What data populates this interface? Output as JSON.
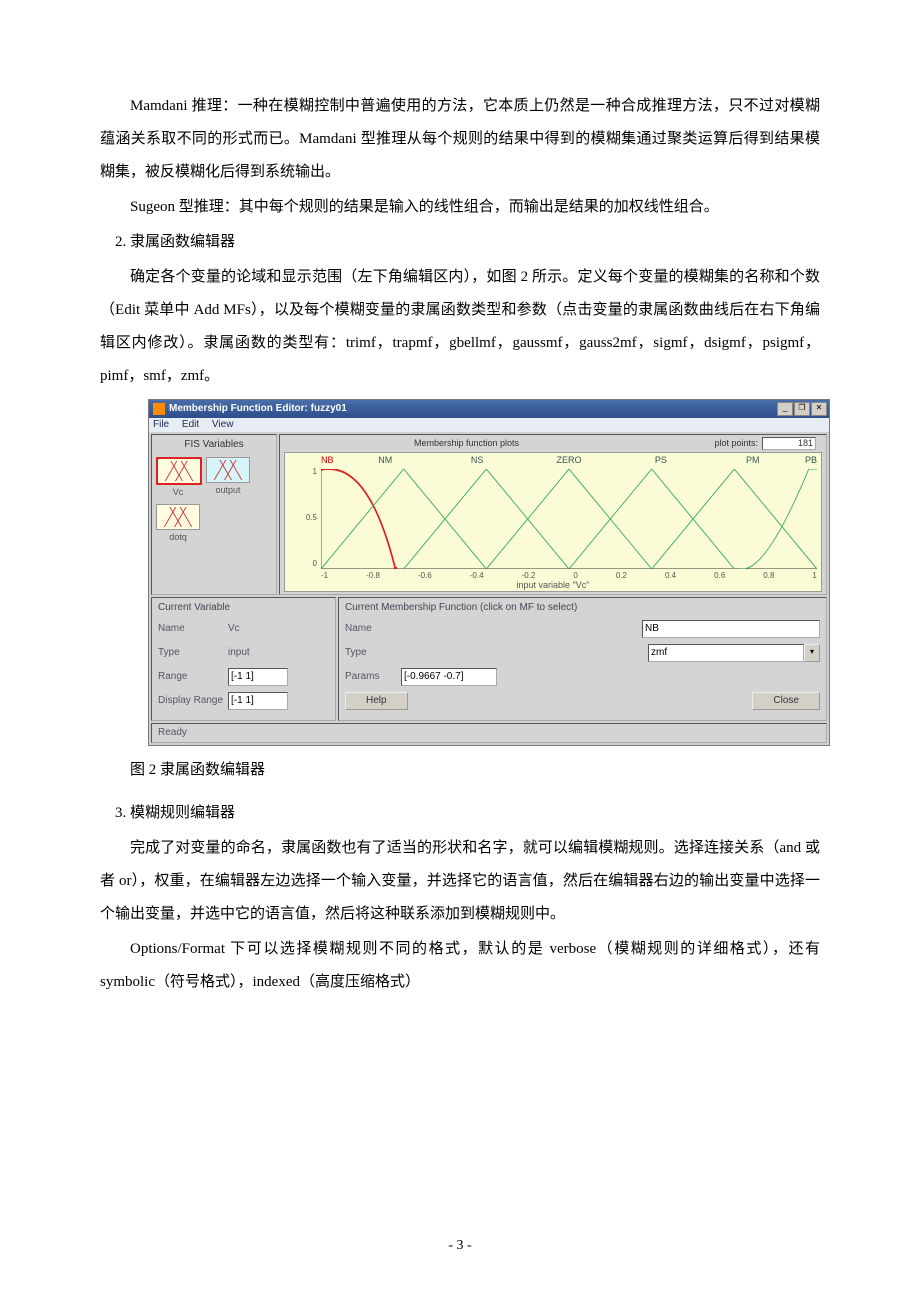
{
  "paragraphs": {
    "p1": "Mamdani 推理：一种在模糊控制中普遍使用的方法，它本质上仍然是一种合成推理方法，只不过对模糊蕴涵关系取不同的形式而已。Mamdani 型推理从每个规则的结果中得到的模糊集通过聚类运算后得到结果模糊集，被反模糊化后得到系统输出。",
    "p2": "Sugeon 型推理：其中每个规则的结果是输入的线性组合，而输出是结果的加权线性组合。",
    "p3": "2.  隶属函数编辑器",
    "p4": "确定各个变量的论域和显示范围（左下角编辑区内），如图 2 所示。定义每个变量的模糊集的名称和个数（Edit 菜单中 Add MFs），以及每个模糊变量的隶属函数类型和参数（点击变量的隶属函数曲线后在右下角编辑区内修改）。隶属函数的类型有：trimf，trapmf，gbellmf，gaussmf，gauss2mf，sigmf，dsigmf，psigmf，pimf，smf，zmf。",
    "caption": "图 2  隶属函数编辑器",
    "p5": "3.  模糊规则编辑器",
    "p6": "完成了对变量的命名，隶属函数也有了适当的形状和名字，就可以编辑模糊规则。选择连接关系（and 或者 or），权重，在编辑器左边选择一个输入变量，并选择它的语言值，然后在编辑器右边的输出变量中选择一个输出变量，并选中它的语言值，然后将这种联系添加到模糊规则中。",
    "p7": "Options/Format 下可以选择模糊规则不同的格式，默认的是 verbose（模糊规则的详细格式），还有 symbolic（符号格式），indexed（高度压缩格式）"
  },
  "page_number": "- 3 -",
  "editor": {
    "title": "Membership Function Editor: fuzzy01",
    "menu": {
      "file": "File",
      "edit": "Edit",
      "view": "View"
    },
    "fis_title": "FIS Variables",
    "vars": {
      "vc": "Vc",
      "output": "output",
      "dotq": "dotq"
    },
    "plot_header": "Membership function plots",
    "plot_points_label": "plot points:",
    "plot_points_value": "181",
    "mf_names": {
      "nb": "NB",
      "nm": "NM",
      "ns": "NS",
      "zero": "ZERO",
      "ps": "PS",
      "pm": "PM",
      "pb": "PB"
    },
    "y_ticks": {
      "t1": "1",
      "t05": "0.5",
      "t0": "0"
    },
    "x_ticks": {
      "m1": "-1",
      "m08": "-0.8",
      "m06": "-0.6",
      "m04": "-0.4",
      "m02": "-0.2",
      "z": "0",
      "p02": "0.2",
      "p04": "0.4",
      "p06": "0.6",
      "p08": "0.8",
      "p1": "1"
    },
    "x_label": "input variable \"Vc\"",
    "cv": {
      "title": "Current Variable",
      "name_lbl": "Name",
      "name_val": "Vc",
      "type_lbl": "Type",
      "type_val": "input",
      "range_lbl": "Range",
      "range_val": "[-1 1]",
      "disp_lbl": "Display Range",
      "disp_val": "[-1 1]"
    },
    "cmf": {
      "title": "Current Membership Function (click on MF to select)",
      "name_lbl": "Name",
      "name_val": "NB",
      "type_lbl": "Type",
      "type_val": "zmf",
      "params_lbl": "Params",
      "params_val": "[-0.9667 -0.7]",
      "help": "Help",
      "close": "Close"
    },
    "status": "Ready"
  }
}
